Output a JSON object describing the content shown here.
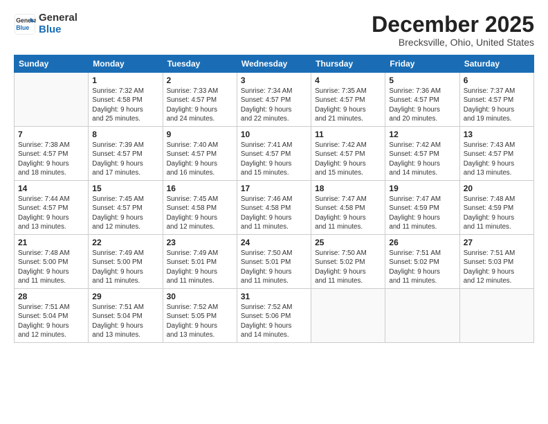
{
  "logo": {
    "general": "General",
    "blue": "Blue"
  },
  "title": "December 2025",
  "location": "Brecksville, Ohio, United States",
  "weekdays": [
    "Sunday",
    "Monday",
    "Tuesday",
    "Wednesday",
    "Thursday",
    "Friday",
    "Saturday"
  ],
  "weeks": [
    [
      {
        "day": "",
        "info": ""
      },
      {
        "day": "1",
        "info": "Sunrise: 7:32 AM\nSunset: 4:58 PM\nDaylight: 9 hours\nand 25 minutes."
      },
      {
        "day": "2",
        "info": "Sunrise: 7:33 AM\nSunset: 4:57 PM\nDaylight: 9 hours\nand 24 minutes."
      },
      {
        "day": "3",
        "info": "Sunrise: 7:34 AM\nSunset: 4:57 PM\nDaylight: 9 hours\nand 22 minutes."
      },
      {
        "day": "4",
        "info": "Sunrise: 7:35 AM\nSunset: 4:57 PM\nDaylight: 9 hours\nand 21 minutes."
      },
      {
        "day": "5",
        "info": "Sunrise: 7:36 AM\nSunset: 4:57 PM\nDaylight: 9 hours\nand 20 minutes."
      },
      {
        "day": "6",
        "info": "Sunrise: 7:37 AM\nSunset: 4:57 PM\nDaylight: 9 hours\nand 19 minutes."
      }
    ],
    [
      {
        "day": "7",
        "info": "Sunrise: 7:38 AM\nSunset: 4:57 PM\nDaylight: 9 hours\nand 18 minutes."
      },
      {
        "day": "8",
        "info": "Sunrise: 7:39 AM\nSunset: 4:57 PM\nDaylight: 9 hours\nand 17 minutes."
      },
      {
        "day": "9",
        "info": "Sunrise: 7:40 AM\nSunset: 4:57 PM\nDaylight: 9 hours\nand 16 minutes."
      },
      {
        "day": "10",
        "info": "Sunrise: 7:41 AM\nSunset: 4:57 PM\nDaylight: 9 hours\nand 15 minutes."
      },
      {
        "day": "11",
        "info": "Sunrise: 7:42 AM\nSunset: 4:57 PM\nDaylight: 9 hours\nand 15 minutes."
      },
      {
        "day": "12",
        "info": "Sunrise: 7:42 AM\nSunset: 4:57 PM\nDaylight: 9 hours\nand 14 minutes."
      },
      {
        "day": "13",
        "info": "Sunrise: 7:43 AM\nSunset: 4:57 PM\nDaylight: 9 hours\nand 13 minutes."
      }
    ],
    [
      {
        "day": "14",
        "info": "Sunrise: 7:44 AM\nSunset: 4:57 PM\nDaylight: 9 hours\nand 13 minutes."
      },
      {
        "day": "15",
        "info": "Sunrise: 7:45 AM\nSunset: 4:57 PM\nDaylight: 9 hours\nand 12 minutes."
      },
      {
        "day": "16",
        "info": "Sunrise: 7:45 AM\nSunset: 4:58 PM\nDaylight: 9 hours\nand 12 minutes."
      },
      {
        "day": "17",
        "info": "Sunrise: 7:46 AM\nSunset: 4:58 PM\nDaylight: 9 hours\nand 11 minutes."
      },
      {
        "day": "18",
        "info": "Sunrise: 7:47 AM\nSunset: 4:58 PM\nDaylight: 9 hours\nand 11 minutes."
      },
      {
        "day": "19",
        "info": "Sunrise: 7:47 AM\nSunset: 4:59 PM\nDaylight: 9 hours\nand 11 minutes."
      },
      {
        "day": "20",
        "info": "Sunrise: 7:48 AM\nSunset: 4:59 PM\nDaylight: 9 hours\nand 11 minutes."
      }
    ],
    [
      {
        "day": "21",
        "info": "Sunrise: 7:48 AM\nSunset: 5:00 PM\nDaylight: 9 hours\nand 11 minutes."
      },
      {
        "day": "22",
        "info": "Sunrise: 7:49 AM\nSunset: 5:00 PM\nDaylight: 9 hours\nand 11 minutes."
      },
      {
        "day": "23",
        "info": "Sunrise: 7:49 AM\nSunset: 5:01 PM\nDaylight: 9 hours\nand 11 minutes."
      },
      {
        "day": "24",
        "info": "Sunrise: 7:50 AM\nSunset: 5:01 PM\nDaylight: 9 hours\nand 11 minutes."
      },
      {
        "day": "25",
        "info": "Sunrise: 7:50 AM\nSunset: 5:02 PM\nDaylight: 9 hours\nand 11 minutes."
      },
      {
        "day": "26",
        "info": "Sunrise: 7:51 AM\nSunset: 5:02 PM\nDaylight: 9 hours\nand 11 minutes."
      },
      {
        "day": "27",
        "info": "Sunrise: 7:51 AM\nSunset: 5:03 PM\nDaylight: 9 hours\nand 12 minutes."
      }
    ],
    [
      {
        "day": "28",
        "info": "Sunrise: 7:51 AM\nSunset: 5:04 PM\nDaylight: 9 hours\nand 12 minutes."
      },
      {
        "day": "29",
        "info": "Sunrise: 7:51 AM\nSunset: 5:04 PM\nDaylight: 9 hours\nand 13 minutes."
      },
      {
        "day": "30",
        "info": "Sunrise: 7:52 AM\nSunset: 5:05 PM\nDaylight: 9 hours\nand 13 minutes."
      },
      {
        "day": "31",
        "info": "Sunrise: 7:52 AM\nSunset: 5:06 PM\nDaylight: 9 hours\nand 14 minutes."
      },
      {
        "day": "",
        "info": ""
      },
      {
        "day": "",
        "info": ""
      },
      {
        "day": "",
        "info": ""
      }
    ]
  ]
}
